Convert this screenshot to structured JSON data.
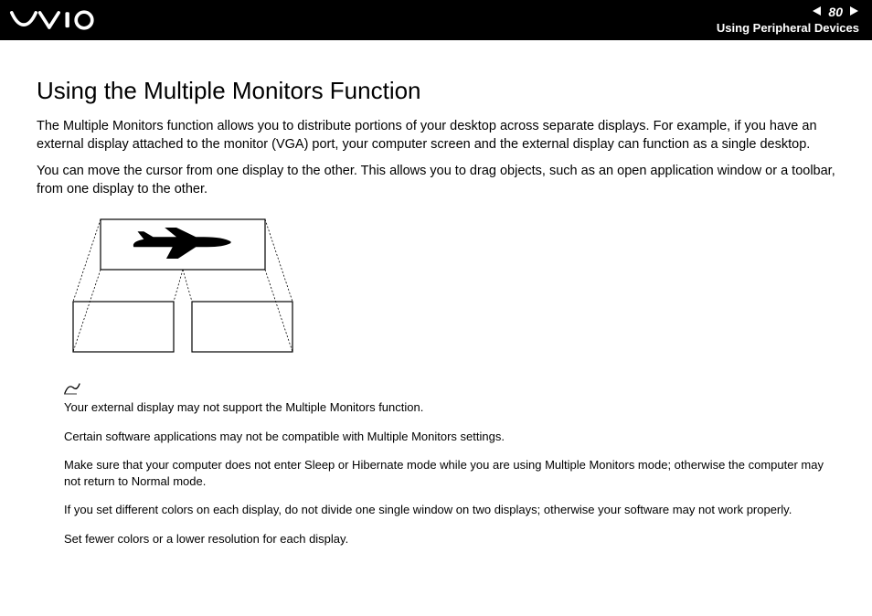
{
  "header": {
    "page_number": "80",
    "section": "Using Peripheral Devices"
  },
  "title": "Using the Multiple Monitors Function",
  "para1": "The Multiple Monitors function allows you to distribute portions of your desktop across separate displays. For example, if you have an external display attached to the monitor (VGA) port, your computer screen and the external display can function as a single desktop.",
  "para2": "You can move the cursor from one display to the other. This allows you to drag objects, such as an open application window or a toolbar, from one display to the other.",
  "notes": {
    "n1": "Your external display may not support the Multiple Monitors function.",
    "n2": "Certain software applications may not be compatible with Multiple Monitors settings.",
    "n3": "Make sure that your computer does not enter Sleep or Hibernate mode while you are using Multiple Monitors mode; otherwise the computer may not return to Normal mode.",
    "n4": "If you set different colors on each display, do not divide one single window on two displays; otherwise your software may not work properly.",
    "n5": "Set fewer colors or a lower resolution for each display."
  }
}
